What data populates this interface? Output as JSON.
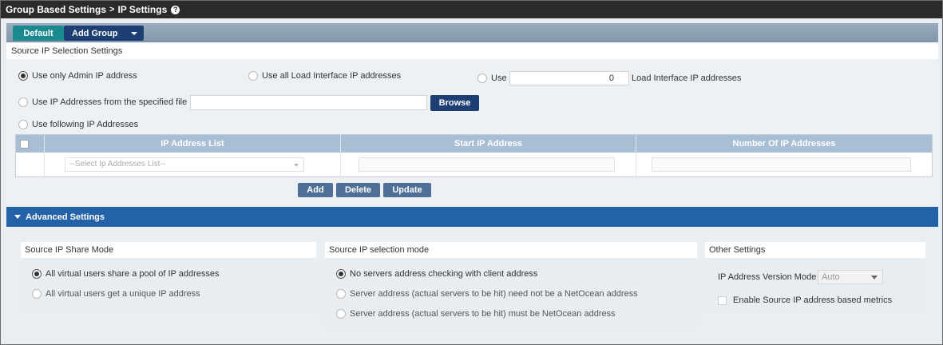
{
  "titlebar": {
    "crumb1": "Group Based Settings",
    "separator": ">",
    "crumb2": "IP Settings",
    "help_icon": "?"
  },
  "toolbar": {
    "default_label": "Default",
    "add_group_label": "Add Group"
  },
  "source_ip": {
    "section_title": "Source IP Selection Settings",
    "opt_admin": "Use only Admin IP address",
    "opt_all_load": "Use all Load Interface IP addresses",
    "opt_use": "Use",
    "use_count_value": "0",
    "load_suffix": "Load Interface IP addresses",
    "opt_file": "Use IP Addresses from the specified file",
    "file_value": "",
    "browse_label": "Browse",
    "opt_following": "Use following IP Addresses"
  },
  "grid": {
    "columns": [
      "IP Address List",
      "Start IP Address",
      "Number Of IP Addresses"
    ],
    "select_placeholder": "--Select Ip Addresses List--"
  },
  "actions": {
    "add": "Add",
    "delete": "Delete",
    "update": "Update"
  },
  "advanced": {
    "title": "Advanced Settings",
    "share_mode": {
      "title": "Source IP Share Mode",
      "opt1": "All virtual users share a pool of IP addresses",
      "opt2": "All virtual users get a unique IP address"
    },
    "selection_mode": {
      "title": "Source IP selection mode",
      "opt1": "No servers address checking with client address",
      "opt2": "Server address (actual servers to be hit) need not be a NetOcean address",
      "opt3": "Server address (actual servers to be hit) must be NetOcean address"
    },
    "other": {
      "title": "Other Settings",
      "version_label": "IP Address Version Mode",
      "version_value": "Auto",
      "metrics_label": "Enable Source IP address based metrics"
    }
  }
}
